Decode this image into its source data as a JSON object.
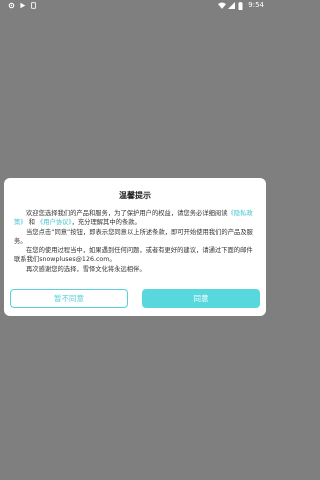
{
  "status_bar": {
    "time": "9:54",
    "left_icons": [
      "gear-icon",
      "play-icon",
      "rotation-icon"
    ],
    "right_icons": [
      "wifi-icon",
      "signal-icon",
      "battery-icon"
    ]
  },
  "dialog": {
    "title": "温馨提示",
    "para1_prefix": "欢迎您选择我们的产品和服务，为了保护用户的权益，请您务必详细阅读",
    "privacy_link": "《隐私政策》",
    "and_text": "和",
    "agreement_link": "《用户协议》",
    "para1_suffix": "，充分理解其中的条款。",
    "para2": "当您点击“同意”按钮，即表示您同意以上所述条款，即可开始使用我们的产品及服务。",
    "para3": "在您的使用过程当中，如果遇到任何问题，或者有更好的建议，请通过下面的邮件联系我们snowpluses@126.com。",
    "para4": "再次感谢您的选择，雪怿文化将永远相伴。",
    "decline_label": "暂不同意",
    "accept_label": "同意"
  },
  "colors": {
    "overlay": "#7f7f7f",
    "accent": "#58d8dc",
    "link": "#3cc6cf"
  }
}
